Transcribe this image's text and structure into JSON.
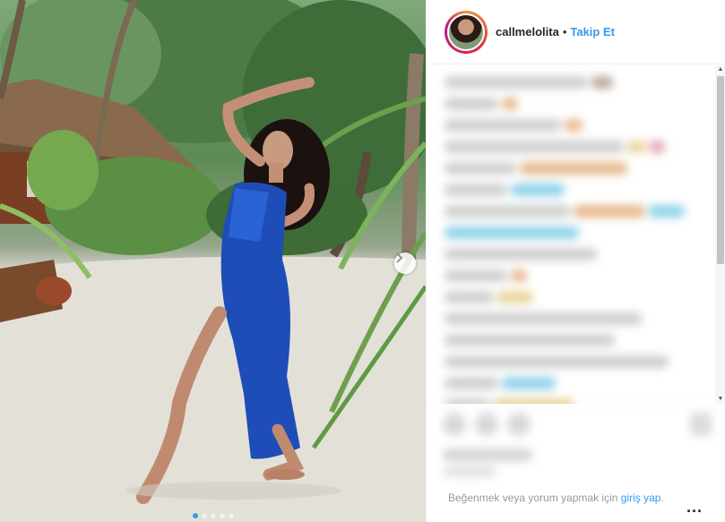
{
  "post": {
    "username": "callmelolita",
    "separator": "•",
    "follow_label": "Takip Et",
    "login_prompt": "Beğenmek veya yorum yapmak için",
    "login_link": "giriş yap",
    "login_end": ".",
    "more_label": "..."
  },
  "carousel": {
    "slide_count": 5,
    "active_slide": 1,
    "next_icon": "chevron-right-icon"
  },
  "colors": {
    "accent": "#3897f0",
    "dress": "#1f4db8",
    "avatar_ring": "#dc2743"
  }
}
